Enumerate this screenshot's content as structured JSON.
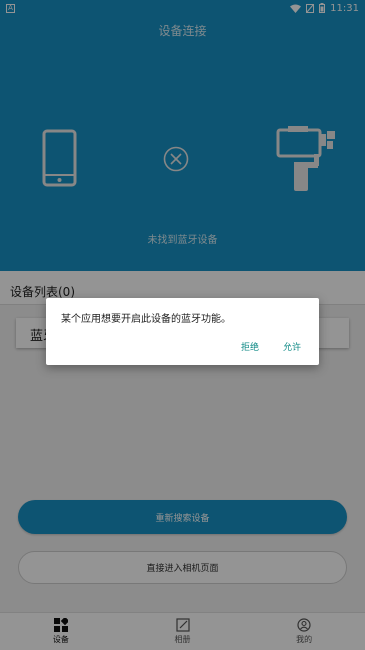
{
  "status_bar": {
    "notification_glyph": "A",
    "time": "11:31",
    "icons": [
      "wifi-icon",
      "mute-icon",
      "battery-icon"
    ]
  },
  "header": {
    "title": "设备连接",
    "status_text": "未找到蓝牙设备",
    "icons": [
      "phone-icon",
      "disconnect-icon",
      "gimbal-icon"
    ]
  },
  "device_list": {
    "title": "设备列表(0)",
    "card_text": "蓝牙"
  },
  "buttons": {
    "research": "重新搜索设备",
    "enter_camera": "直接进入相机页面"
  },
  "bottom_nav": [
    {
      "label": "设备",
      "icon": "device-grid-icon",
      "active": true
    },
    {
      "label": "相册",
      "icon": "album-edit-icon",
      "active": false
    },
    {
      "label": "我的",
      "icon": "profile-icon",
      "active": false
    }
  ],
  "dialog": {
    "message": "某个应用想要开启此设备的蓝牙功能。",
    "deny": "拒绝",
    "allow": "允许"
  },
  "colors": {
    "primary": "#1792c4",
    "accent_text": "#0f8a86"
  }
}
